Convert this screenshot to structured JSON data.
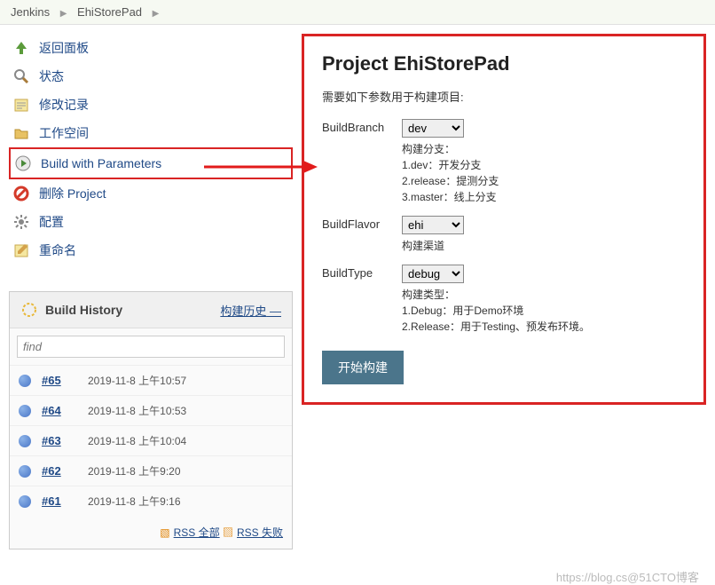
{
  "breadcrumb": {
    "root": "Jenkins",
    "project": "EhiStorePad"
  },
  "sidebar": {
    "items": [
      {
        "label": "返回面板"
      },
      {
        "label": "状态"
      },
      {
        "label": "修改记录"
      },
      {
        "label": "工作空间"
      },
      {
        "label": "Build with Parameters"
      },
      {
        "label": "删除 Project"
      },
      {
        "label": "配置"
      },
      {
        "label": "重命名"
      }
    ]
  },
  "buildHistory": {
    "title": "Build History",
    "link": "构建历史",
    "searchPlaceholder": "find",
    "builds": [
      {
        "num": "#65",
        "time": "2019-11-8 上午10:57"
      },
      {
        "num": "#64",
        "time": "2019-11-8 上午10:53"
      },
      {
        "num": "#63",
        "time": "2019-11-8 上午10:04"
      },
      {
        "num": "#62",
        "time": "2019-11-8 上午9:20"
      },
      {
        "num": "#61",
        "time": "2019-11-8 上午9:16"
      }
    ],
    "rssAll": "RSS 全部",
    "rssFailed": "RSS 失败"
  },
  "form": {
    "title": "Project EhiStorePad",
    "desc": "需要如下参数用于构建项目:",
    "params": {
      "branch": {
        "label": "BuildBranch",
        "value": "dev",
        "help": "构建分支：\n1.dev：开发分支\n2.release：提测分支\n3.master：线上分支"
      },
      "flavor": {
        "label": "BuildFlavor",
        "value": "ehi",
        "help": "构建渠道"
      },
      "type": {
        "label": "BuildType",
        "value": "debug",
        "help": "构建类型：\n1.Debug：用于Demo环境\n2.Release：用于Testing、预发布环境。"
      }
    },
    "buildBtn": "开始构建"
  },
  "watermark": "https://blog.cs@51CTO博客"
}
